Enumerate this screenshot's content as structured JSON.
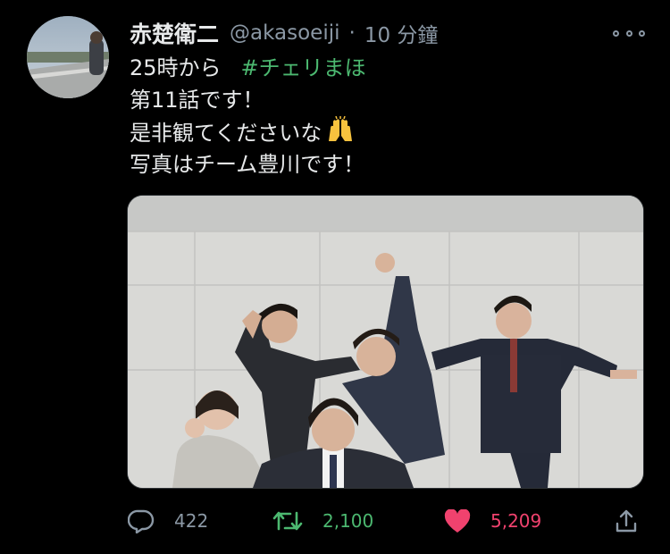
{
  "tweet": {
    "display_name": "赤楚衛二",
    "handle": "@akasoeiji",
    "separator": "·",
    "time": "10 分鐘",
    "lines": {
      "line1_text": "25時から",
      "line1_hashtag": "#チェリまほ",
      "line2": "第11話です！",
      "line3": "是非観てくださいな",
      "line4": "写真はチーム豊川です！"
    },
    "emoji": "raising-hands"
  },
  "actions": {
    "reply_count": "422",
    "retweet_count": "2,100",
    "like_count": "5,209"
  },
  "colors": {
    "background": "#000000",
    "text": "#e7e9ea",
    "muted": "#8b98a5",
    "hashtag": "#4cb870",
    "retweet": "#4cb870",
    "like": "#f0426e"
  }
}
